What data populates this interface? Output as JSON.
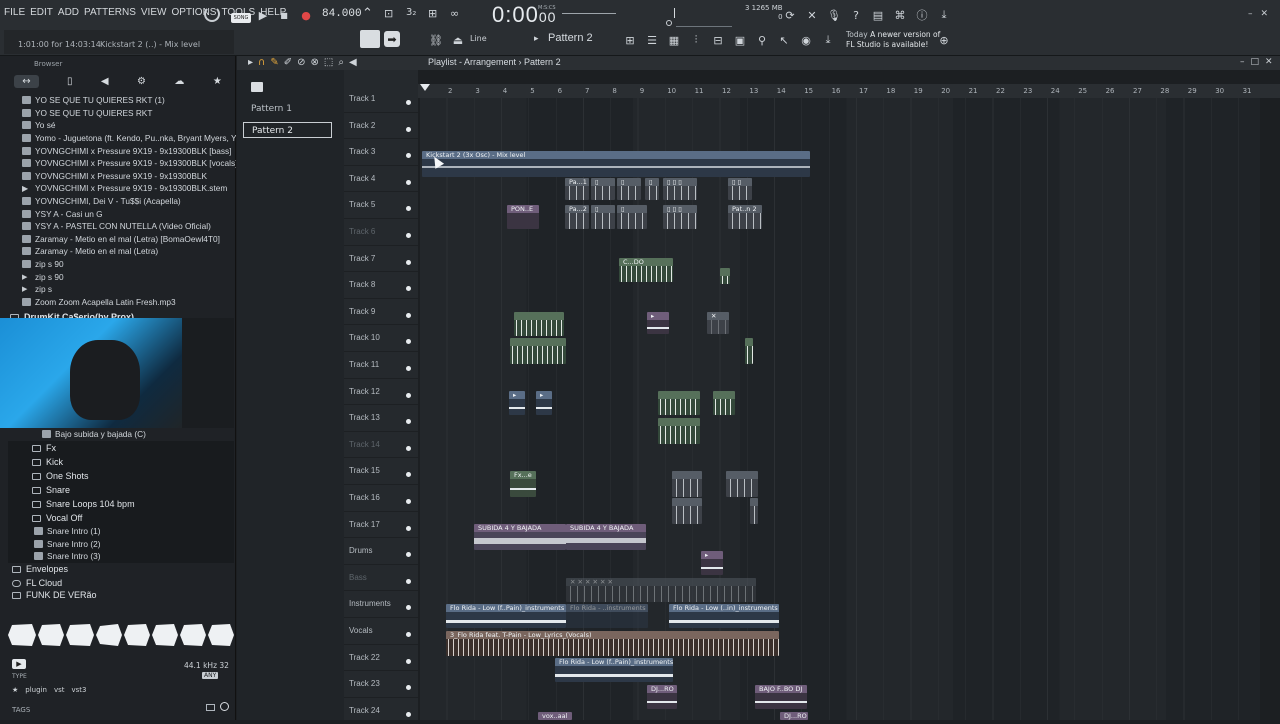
{
  "menu": [
    "FILE",
    "EDIT",
    "ADD",
    "PATTERNS",
    "VIEW",
    "OPTIONS",
    "TOOLS",
    "HELP"
  ],
  "hint_time": "1:01:00 for 14:03:14",
  "hint_text": "Kickstart 2 (..) - Mix level",
  "song_label": "SONG",
  "tempo": "84.000",
  "time_display": "0:00",
  "time_frac": "00",
  "time_unit": "M:S:CS",
  "mem_top": "3   1265 MB",
  "mem_bottom": "0",
  "line_mode": "Line",
  "current_pattern": "Pattern 2",
  "news_day": "Today",
  "news_text": "A newer version of",
  "news_text2": "FL Studio is available!",
  "browser": {
    "title": "Browser",
    "tabs": [
      "↔",
      "▯",
      "◀",
      "⚙",
      "☁",
      "★"
    ],
    "files": [
      "YO SE QUE TU QUIERES RKT (1)",
      "YO SE QUE TU QUIERES RKT",
      "Yo sé",
      "Yomo - Juguetona (ft. Kendo, Pu..nka, Bryant Myers, Young Izak)",
      "YOVNGCHIMI x Pressure 9X19 - 9x19300BLK [bass]",
      "YOVNGCHIMI x Pressure 9X19 - 9x19300BLK [vocals]",
      "YOVNGCHIMI x Pressure 9X19 - 9x19300BLK",
      "YOVNGCHIMI x Pressure 9X19 - 9x19300BLK.stem",
      "YOVNGCHIMI, Dei V - Tu$$i (Acapella)",
      "YSY A - Casi un G",
      "YSY A - PASTEL CON NUTELLA (Video Oficial)",
      "Zaramay - Metio en el mal (Letra) [BomaOewl4T0]",
      "Zaramay - Metio en el mal (Letra)",
      "zip s 90",
      "zip s 90",
      "zip s",
      "Zoom Zoom Acapella Latin Fresh.mp3"
    ],
    "drumkit": "DrumKit Ca$erio(by Prox)",
    "sub_item": "Bajo subida y bajada (C)",
    "folders": [
      "Fx",
      "Kick",
      "One Shots",
      "Snare",
      "Snare Loops 104 bpm",
      "Vocal Off"
    ],
    "snare_intros": [
      "Snare Intro (1)",
      "Snare Intro (2)",
      "Snare Intro (3)"
    ],
    "root_folders": [
      "Envelopes",
      "FL Cloud",
      "FUNK DE VERão"
    ],
    "samplerate": "44.1 kHz 32",
    "any": "ANY",
    "type_label": "TYPE",
    "plugin_tags": [
      "plugin",
      "vst",
      "vst3"
    ],
    "tags_label": "TAGS"
  },
  "patterns": [
    "Pattern 1",
    "Pattern 2"
  ],
  "playlist": {
    "title": "Playlist - Arrangement",
    "pattern": "Pattern 2",
    "bar_numbers": [
      "2",
      "3",
      "4",
      "5",
      "6",
      "7",
      "8",
      "9",
      "10",
      "11",
      "12",
      "13",
      "14",
      "15",
      "16",
      "17",
      "18",
      "19",
      "20",
      "21",
      "22",
      "23",
      "24",
      "25",
      "26",
      "27",
      "28",
      "29",
      "30",
      "31"
    ],
    "tracks": [
      {
        "name": "Track 1",
        "dim": false
      },
      {
        "name": "Track 2",
        "dim": false
      },
      {
        "name": "Track 3",
        "dim": false
      },
      {
        "name": "Track 4",
        "dim": false
      },
      {
        "name": "Track 5",
        "dim": false
      },
      {
        "name": "Track 6",
        "dim": true
      },
      {
        "name": "Track 7",
        "dim": false
      },
      {
        "name": "Track 8",
        "dim": false
      },
      {
        "name": "Track 9",
        "dim": false
      },
      {
        "name": "Track 10",
        "dim": false
      },
      {
        "name": "Track 11",
        "dim": false
      },
      {
        "name": "Track 12",
        "dim": false
      },
      {
        "name": "Track 13",
        "dim": false
      },
      {
        "name": "Track 14",
        "dim": true
      },
      {
        "name": "Track 15",
        "dim": false
      },
      {
        "name": "Track 16",
        "dim": false
      },
      {
        "name": "Track 17",
        "dim": false
      },
      {
        "name": "Drums",
        "dim": false
      },
      {
        "name": "Bass",
        "dim": true
      },
      {
        "name": "Instruments",
        "dim": false
      },
      {
        "name": "Vocals",
        "dim": false
      },
      {
        "name": "Track 22",
        "dim": false
      },
      {
        "name": "Track 23",
        "dim": false
      },
      {
        "name": "Track 24",
        "dim": false
      }
    ],
    "clips": {
      "kickstart": "Kickstart 2 (3x Osc) - Mix level",
      "pon": "PON..E",
      "pa": "Pa...1",
      "pa2": "Pa...2",
      "pat_n2": "Pat..n 2",
      "c_do": "C...DO",
      "fx": "Fx...e",
      "subida": "SUBIDA 4 Y BAJADA",
      "subida2": "SUBIDA 4 Y BAJADA",
      "flo1": "Flo Rida - Low (f..Pain)_instruments",
      "flo1b": "Flo Rida - ..instruments",
      "flo2": "Flo Rida - Low (..in)_instruments",
      "vocals": "3_Flo Rida feat. T-Pain - Low_Lyrics_(Vocals)",
      "flo3": "Flo Rida - Low (f..Pain)_instruments",
      "dj": "DJ...RO",
      "bajo": "BAJO F..BO DJ",
      "vox": "vox..aal",
      "dj2": "DJ...RO"
    }
  }
}
